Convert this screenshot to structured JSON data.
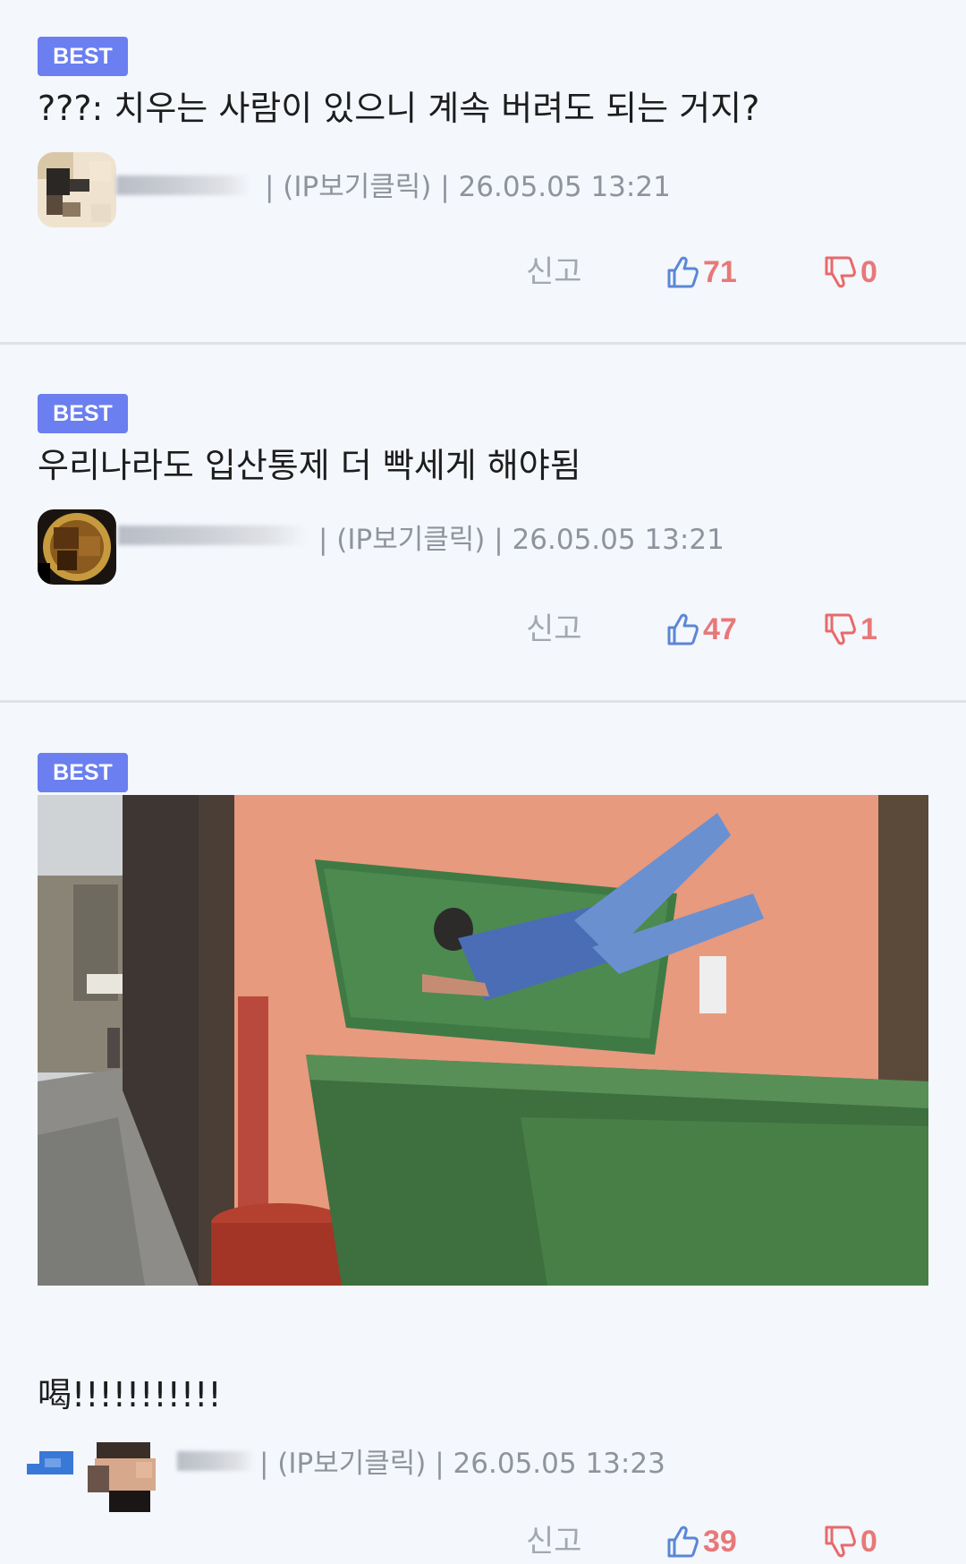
{
  "comments": [
    {
      "badge": "BEST",
      "text": "???: 치우는 사람이 있으니 계속 버려도 되는 거지?",
      "meta": "| (IP보기클릭) | 26.05.05 13:21",
      "report_label": "신고",
      "likes": "71",
      "dislikes": "0"
    },
    {
      "badge": "BEST",
      "text": "우리나라도 입산통제 더 빡세게 해야됨",
      "meta": "| (IP보기클릭) | 26.05.05 13:21",
      "report_label": "신고",
      "likes": "47",
      "dislikes": "1"
    },
    {
      "badge": "BEST",
      "text": "喝!!!!!!!!!!!",
      "meta": "| (IP보기클릭) | 26.05.05 13:23",
      "report_label": "신고",
      "likes": "39",
      "dislikes": "0"
    }
  ],
  "colors": {
    "badge": "#6b7ff0",
    "like_icon": "#5a87d6",
    "vote_count": "#e87878",
    "dislike_icon": "#e86a6a",
    "background": "#f4f7fc"
  },
  "icons": {
    "like": "thumbs-up-icon",
    "dislike": "thumbs-down-icon",
    "reply": "reply-arrow-icon"
  }
}
